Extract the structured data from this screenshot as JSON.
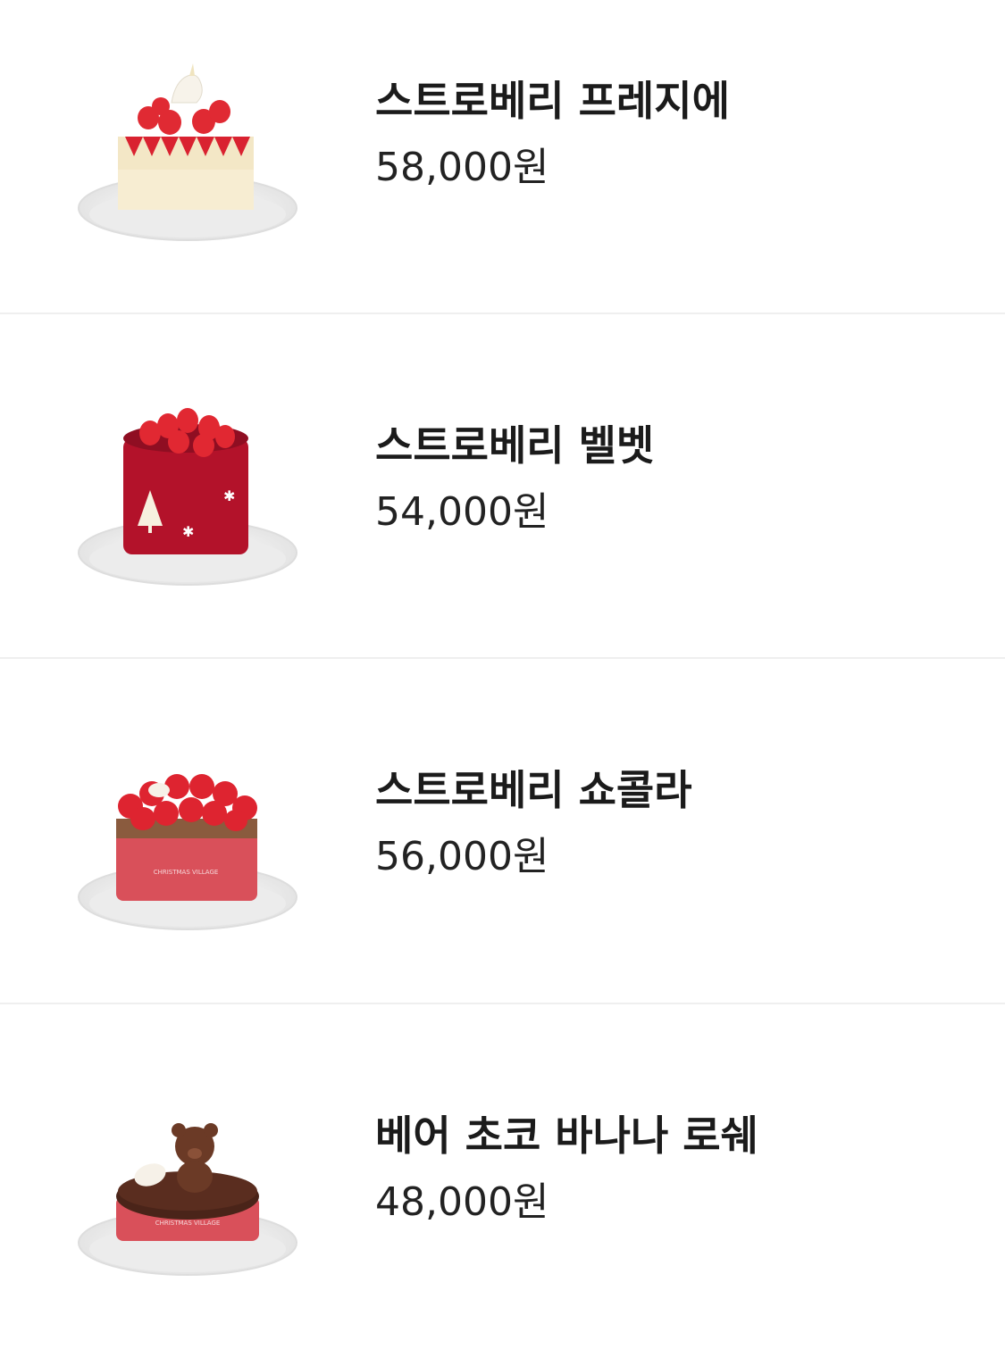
{
  "products": [
    {
      "name": "스트로베리 프레지에",
      "price": "58,000원",
      "icon": "strawberry-fraisier-cake-image"
    },
    {
      "name": "스트로베리 벨벳",
      "price": "54,000원",
      "icon": "strawberry-velvet-cake-image"
    },
    {
      "name": "스트로베리 쇼콜라",
      "price": "56,000원",
      "icon": "strawberry-chocolat-cake-image"
    },
    {
      "name": "베어 초코 바나나 로쉐",
      "price": "48,000원",
      "icon": "bear-choco-banana-rocher-cake-image"
    }
  ],
  "colors": {
    "strawberry": "#d91e2a",
    "velvet": "#b3122a",
    "chocolate": "#4a2419",
    "band": "#d9505a",
    "plate": "#f4f4f4"
  }
}
